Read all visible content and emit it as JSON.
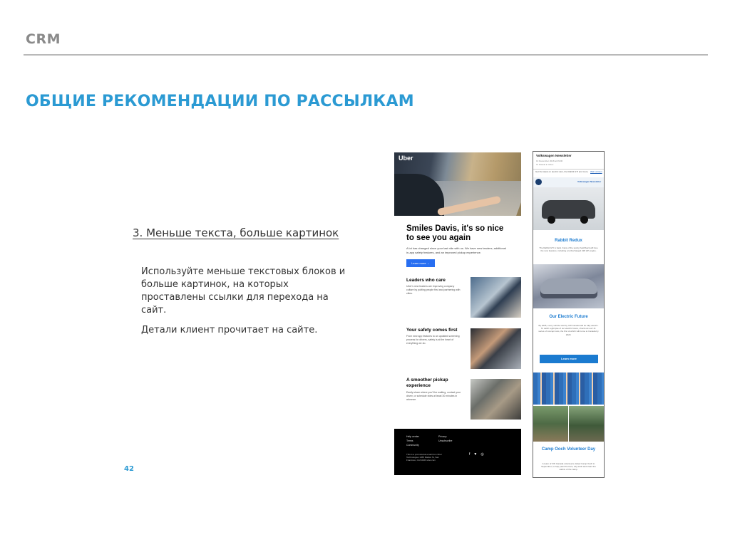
{
  "header": {
    "section": "CRM"
  },
  "slide": {
    "title": "ОБЩИЕ РЕКОМЕНДАЦИИ ПО РАССЫЛКАМ",
    "point_heading": "3. Меньше текста, больше картинок",
    "body": [
      "Используйте меньше текстовых блоков и больше картинок, на которых проставлены ссылки для перехода на сайт.",
      "Детали клиент прочитает на сайте."
    ],
    "page_number": "42"
  },
  "uber_email": {
    "logo": "Uber",
    "greeting": "Smiles Davis, it's so nice to see you again",
    "intro": "A lot has changed since your last ride with us. We have new leaders, additional in-app safety features, and an improved pickup experience.",
    "cta": "Learn more →",
    "sections": [
      {
        "title": "Leaders who care",
        "text": "Uber's new leaders are improving company culture by putting people first and partnering with cities."
      },
      {
        "title": "Your safety comes first",
        "text": "From new app features to an updated screening process for drivers, safety is at the heart of everything we do."
      },
      {
        "title": "A smoother pickup experience",
        "text": "Easily share where you'll be waiting, contact your driver, or schedule rides at least 30 minutes in advance."
      }
    ],
    "footer": {
      "links": [
        "Help center",
        "Privacy",
        "Terms",
        "Unsubscribe",
        "Community"
      ],
      "fine_print": "This is a promotional email from Uber Technologies 1455 Market St, San Francisco, CA 94103 uber.com",
      "social_icons": [
        "facebook-icon",
        "twitter-icon",
        "instagram-icon"
      ]
    }
  },
  "vw_email": {
    "title": "Volkswagen Newsletter",
    "date_line": "13 December 2018 at 09:00",
    "sender_line": "To Pascal in Inbox",
    "preheader": "Get the latest on electric cars, the Rabbit GTI and more.",
    "view_online": "Web version",
    "header_label": "Volkswagen Newsletter",
    "blocks": [
      {
        "heading": "Rabbit Redux",
        "text": "The Rabbit GTI is back. Fans of the sporty hatchback will love the new features, including a turbocharged 228 HP engine."
      },
      {
        "heading": "Our Electric Future",
        "text": "By 2025, every vehicle sold by VW Canada will be fully electric. To catch a glimpse of our electric future, check out our I.D. series of concept cars, the first of which will come to Canada by 2020."
      },
      {
        "heading": "Camp Ooch Volunteer Day",
        "text": "A team of VW Canada volunteers visited Camp Ooch in September, to help paint the barn, tidy trails and clean the cabins of the camp."
      }
    ],
    "cta": "Learn more"
  }
}
